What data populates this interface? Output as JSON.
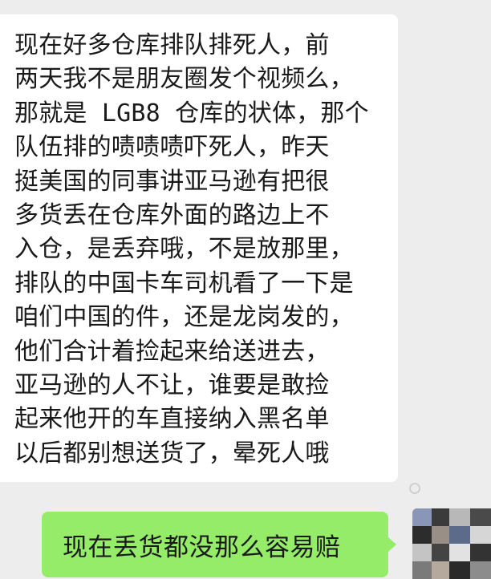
{
  "conversation": {
    "incoming": {
      "lines": [
        "现在好多仓库排队排死人，前",
        "两天我不是朋友圈发个视频么，",
        "那就是 LGB8 仓库的状体，那个",
        "队伍排的啧啧啧吓死人，昨天",
        "挺美国的同事讲亚马逊有把很",
        "多货丢在仓库外面的路边上不",
        "入仓，是丢弃哦，不是放那里，",
        "排队的中国卡车司机看了一下是",
        "咱们中国的件，还是龙岗发的，",
        "他们合计着捡起来给送进去，",
        "亚马逊的人不让，谁要是敢捡",
        "起来他开的车直接纳入黑名单",
        "以后都别想送货了，晕死人哦"
      ]
    },
    "outgoing": {
      "text": "现在丢货都没那么容易赔"
    }
  },
  "colors": {
    "background": "#ededed",
    "incoming_bubble": "#ffffff",
    "outgoing_bubble": "#95ec69"
  }
}
